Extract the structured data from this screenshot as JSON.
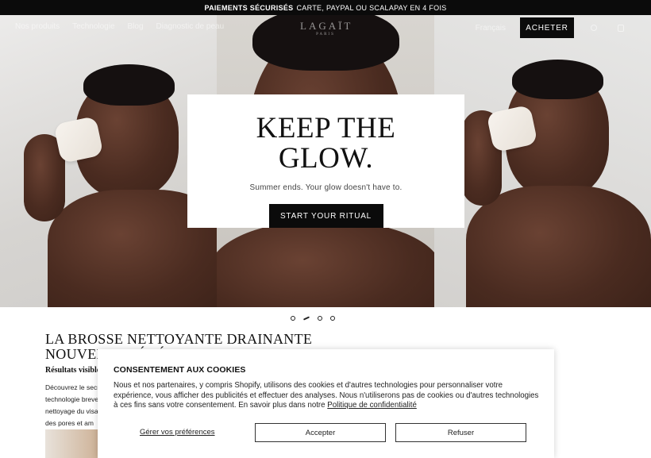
{
  "announcement": {
    "bold": "PAIEMENTS SÉCURISÉS",
    "text": "CARTE, PAYPAL OU SCALAPAY EN 4 FOIS"
  },
  "nav": {
    "items": [
      "Nos produits",
      "Technologie",
      "Blog",
      "Diagnostic de peau"
    ],
    "logo_main": "LAGAÏT",
    "logo_sub": "PARIS",
    "language": "Français",
    "buy_label": "ACHETER",
    "icons": [
      "account-icon",
      "cart-icon"
    ]
  },
  "hero": {
    "title_line1": "KEEP THE",
    "title_line2": "GLOW.",
    "subtitle": "Summer ends. Your glow doesn't have to.",
    "cta_label": "START YOUR RITUAL",
    "slides_count": 4,
    "active_slide": 2
  },
  "product": {
    "title_line1": "LA BROSSE NETTOYANTE DRAINANTE",
    "title_line2": "NOUVELLE GÉNÉRATION",
    "subtitle": "Résultats visibles",
    "desc_lines": [
      "Découvrez le secret",
      "technologie brevetée",
      "nettoyage du visage",
      "des pores et am"
    ]
  },
  "cookie": {
    "title": "CONSENTEMENT AUX COOKIES",
    "text": "Nous et nos partenaires, y compris Shopify, utilisons des cookies et d'autres technologies pour personnaliser votre expérience, vous afficher des publicités et effectuer des analyses. Nous n'utiliserons pas de cookies ou d'autres technologies à ces fins sans votre consentement. En savoir plus dans notre",
    "privacy_link": "Politique de confidentialité",
    "manage_label": "Gérer vos préférences",
    "accept_label": "Accepter",
    "refuse_label": "Refuser"
  },
  "colors": {
    "black": "#0b0b0b",
    "white": "#ffffff"
  }
}
